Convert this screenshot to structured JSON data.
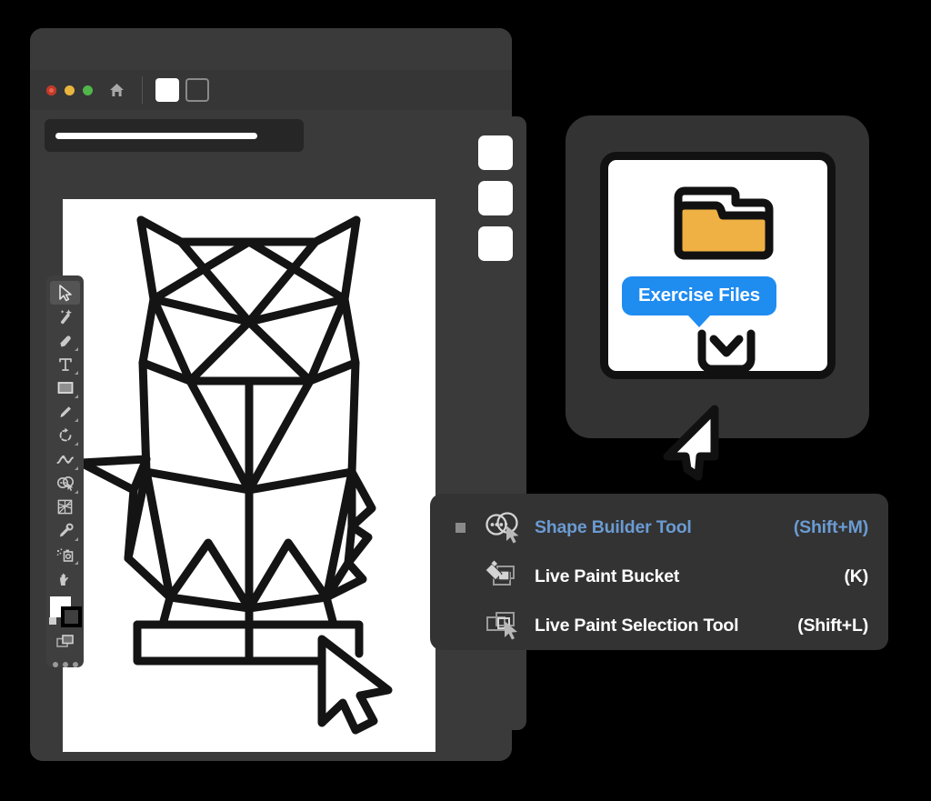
{
  "colors": {
    "page_bg": "#000000",
    "window_bg": "#3a3a3a",
    "menubar_bg": "#363636",
    "card_bg": "#333333",
    "accent_blue": "#1f8cf0",
    "highlight_blue": "#6b9bd2",
    "folder_amber": "#efb143",
    "traffic_red": "#e8614d",
    "traffic_yellow": "#e9b53f",
    "traffic_green": "#52b64b",
    "artboard_white": "#ffffff",
    "icon_gray": "#c9c9c9"
  },
  "app_window": {
    "titlebar": {
      "traffic_lights": [
        {
          "name": "close",
          "color": "#e8614d"
        },
        {
          "name": "minimize",
          "color": "#e9b53f"
        },
        {
          "name": "zoom",
          "color": "#52b64b"
        }
      ],
      "home_icon": "home-icon",
      "fill_swatch": "white",
      "stroke_swatch": "outline"
    },
    "control_bar": {
      "placeholder": ""
    },
    "artboard": {
      "artwork": "geometric-owl-line-art"
    }
  },
  "tool_palette": {
    "tools": [
      {
        "id": "selection",
        "name": "selection-tool",
        "active": true,
        "has_flyout": false
      },
      {
        "id": "magic-wand",
        "name": "magic-wand-tool",
        "active": false,
        "has_flyout": false
      },
      {
        "id": "pen",
        "name": "pen-tool",
        "active": false,
        "has_flyout": true
      },
      {
        "id": "type",
        "name": "type-tool",
        "active": false,
        "has_flyout": true
      },
      {
        "id": "rectangle",
        "name": "rectangle-tool",
        "active": false,
        "has_flyout": true
      },
      {
        "id": "pencil",
        "name": "pencil-tool",
        "active": false,
        "has_flyout": true
      },
      {
        "id": "rotate",
        "name": "rotate-tool",
        "active": false,
        "has_flyout": true
      },
      {
        "id": "width",
        "name": "width-tool",
        "active": false,
        "has_flyout": true
      },
      {
        "id": "shape-builder",
        "name": "shape-builder-tool",
        "active": false,
        "has_flyout": true
      },
      {
        "id": "perspective-grid",
        "name": "perspective-grid-tool",
        "active": false,
        "has_flyout": false
      },
      {
        "id": "eyedropper",
        "name": "eyedropper-tool",
        "active": false,
        "has_flyout": true
      },
      {
        "id": "symbol-sprayer",
        "name": "symbol-sprayer-tool",
        "active": false,
        "has_flyout": true
      },
      {
        "id": "hand",
        "name": "hand-tool",
        "active": false,
        "has_flyout": false
      }
    ],
    "screen_mode_icon": "screen-mode-icon",
    "more_tools_icon": "more-tools-icon"
  },
  "panel_dock": {
    "tiles": [
      {
        "name": "panel-tile-1"
      },
      {
        "name": "panel-tile-2"
      },
      {
        "name": "panel-tile-3"
      }
    ]
  },
  "exercise_card": {
    "folder_icon": "folder-icon",
    "badge_label": "Exercise Files",
    "download_icon": "download-tray-icon",
    "cursor_icon": "cursor-arrow-icon"
  },
  "tool_flyout": {
    "items": [
      {
        "label": "Shape Builder Tool",
        "shortcut": "(Shift+M)",
        "icon": "shape-builder-icon",
        "selected": true
      },
      {
        "label": "Live Paint Bucket",
        "shortcut": "(K)",
        "icon": "live-paint-bucket-icon",
        "selected": false
      },
      {
        "label": "Live Paint Selection Tool",
        "shortcut": "(Shift+L)",
        "icon": "live-paint-selection-icon",
        "selected": false
      }
    ]
  }
}
